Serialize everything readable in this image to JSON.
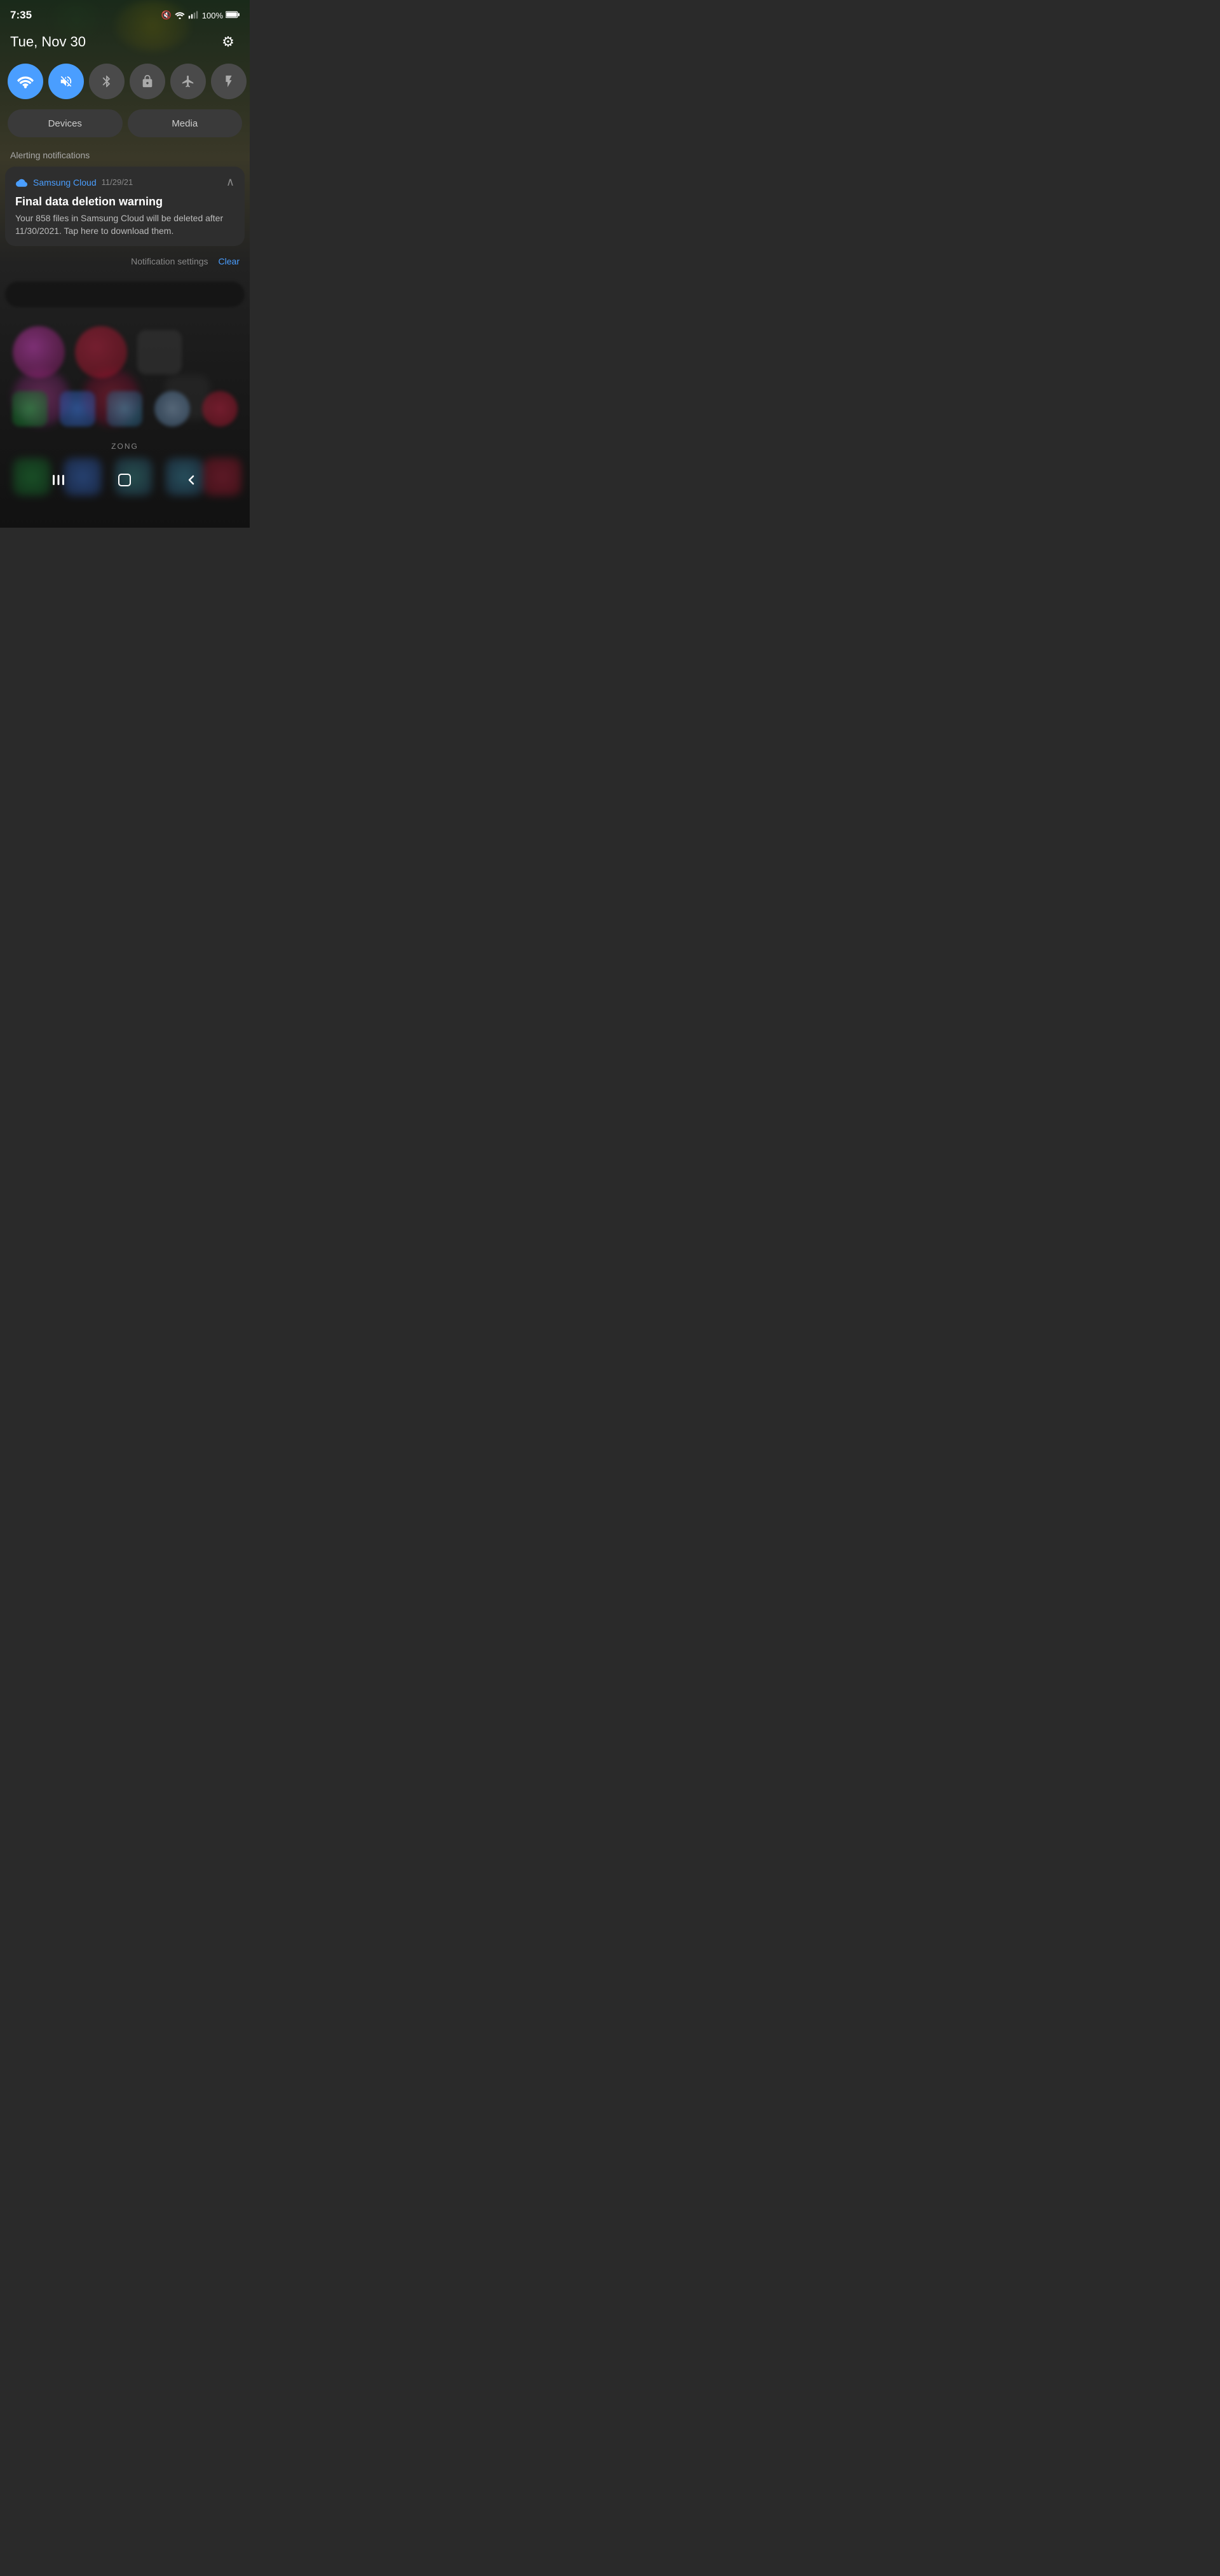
{
  "statusBar": {
    "time": "7:35",
    "batteryPercent": "100%",
    "icons": {
      "mute": "🔇",
      "wifi": "wifi",
      "signal": "signal",
      "battery": "battery"
    }
  },
  "dateRow": {
    "date": "Tue, Nov 30",
    "settingsIcon": "⚙"
  },
  "quickToggles": [
    {
      "id": "wifi",
      "label": "WiFi",
      "active": true,
      "symbol": "wifi"
    },
    {
      "id": "sound",
      "label": "Mute",
      "active": true,
      "symbol": "mute"
    },
    {
      "id": "bluetooth",
      "label": "Bluetooth",
      "active": false,
      "symbol": "bt"
    },
    {
      "id": "screen-lock",
      "label": "Screen Lock",
      "active": false,
      "symbol": "lock"
    },
    {
      "id": "airplane",
      "label": "Airplane Mode",
      "active": false,
      "symbol": "plane"
    },
    {
      "id": "flashlight",
      "label": "Flashlight",
      "active": false,
      "symbol": "flash"
    }
  ],
  "deviceMediaButtons": {
    "devices": "Devices",
    "media": "Media"
  },
  "alertingLabel": "Alerting notifications",
  "notification": {
    "appName": "Samsung Cloud",
    "date": "11/29/21",
    "title": "Final data deletion warning",
    "body": "Your 858 files in Samsung Cloud will be deleted after 11/30/2021. Tap here to download them.",
    "expanded": true
  },
  "notifActions": {
    "settings": "Notification settings",
    "clear": "Clear"
  },
  "carrierText": "ZONG",
  "navBar": {
    "recentApps": "|||",
    "home": "⬜",
    "back": "<"
  }
}
